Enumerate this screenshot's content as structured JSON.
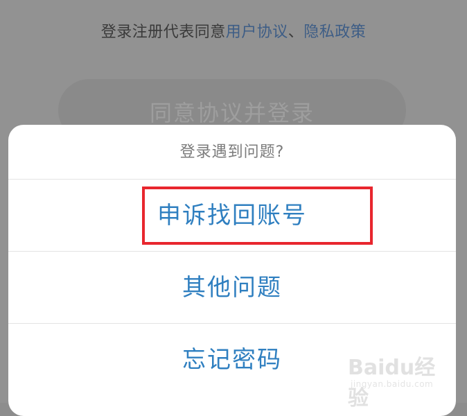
{
  "background": {
    "agreement_prefix": "登录注册代表同意",
    "user_agreement_link": "用户协议",
    "separator": "、",
    "privacy_policy_link": "隐私政策",
    "login_button_label": "同意协议并登录"
  },
  "action_sheet": {
    "title": "登录遇到问题?",
    "options": [
      {
        "label": "申诉找回账号"
      },
      {
        "label": "其他问题"
      },
      {
        "label": "忘记密码"
      }
    ]
  },
  "watermark": {
    "brand": "Baidu经验",
    "url": "jingyan.baidu.com"
  },
  "colors": {
    "link": "#3d5d86",
    "option_text": "#2f7fc0",
    "highlight": "#e8262e",
    "overlay": "#929292"
  }
}
